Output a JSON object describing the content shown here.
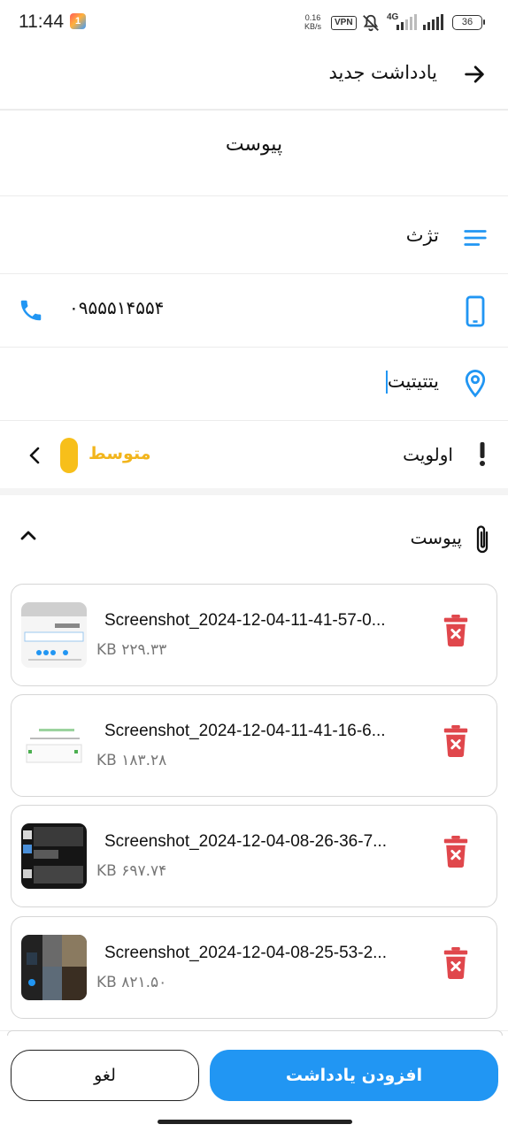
{
  "status_bar": {
    "time": "11:44",
    "app_badge": "1",
    "net_speed_value": "0.16",
    "net_speed_unit": "KB/s",
    "vpn": "VPN",
    "network": "4G",
    "battery": "36"
  },
  "header": {
    "title": "یادداشت جدید",
    "back_icon": "arrow-right-icon"
  },
  "note": {
    "title": "پیوست",
    "description": "تژث",
    "phone": "۰۹۵۵۵۱۴۵۵۴",
    "location": "یتتیتیت",
    "priority_label": "اولویت",
    "priority_value": "متوسط"
  },
  "attachments": {
    "label": "پیوست",
    "expanded": true,
    "items": [
      {
        "name": "Screenshot_2024-12-04-11-41-57-0...",
        "size": "KB ۲۲۹.۳۳"
      },
      {
        "name": "Screenshot_2024-12-04-11-41-16-6...",
        "size": "KB ۱۸۳.۲۸"
      },
      {
        "name": "Screenshot_2024-12-04-08-26-36-7...",
        "size": "KB ۶۹۷.۷۴"
      },
      {
        "name": "Screenshot_2024-12-04-08-25-53-2...",
        "size": "KB ۸۲۱.۵۰"
      }
    ]
  },
  "buttons": {
    "cancel": "لغو",
    "add": "افزودن یادداشت"
  },
  "colors": {
    "accent": "#2196f3",
    "priority": "#f7bf1a",
    "delete": "#e0474c"
  }
}
